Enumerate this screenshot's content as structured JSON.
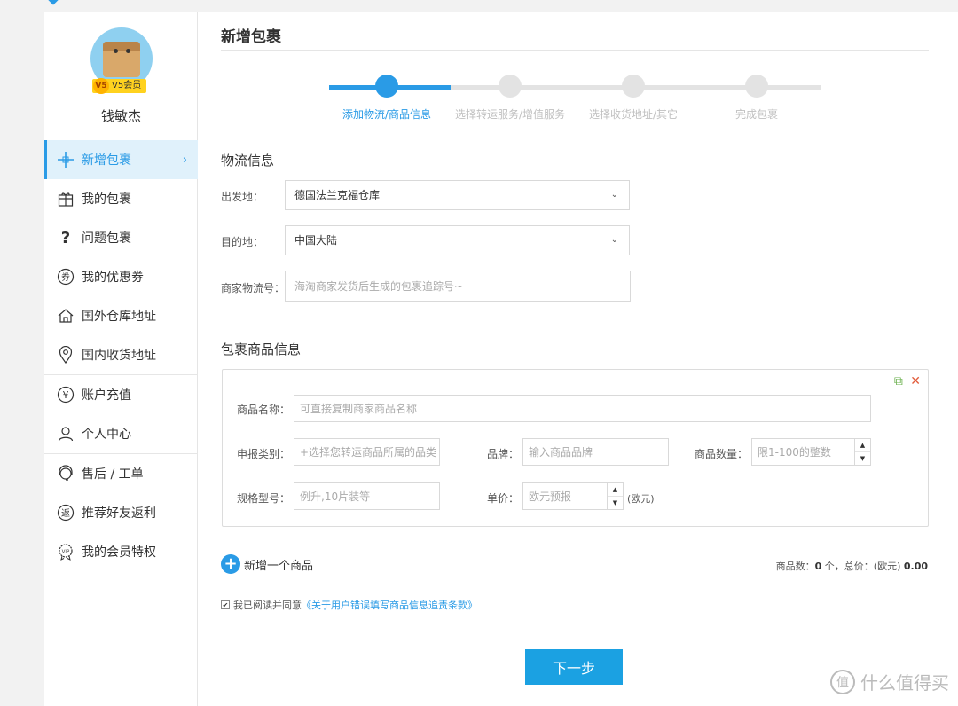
{
  "breadcrumb": "",
  "user": {
    "name": "钱敏杰",
    "vip_level": "V5",
    "vip_label": "V5会员"
  },
  "sidebar": {
    "items": [
      {
        "label": "新增包裹",
        "icon": "plus-icon",
        "active": true
      },
      {
        "label": "我的包裹",
        "icon": "gift-icon",
        "active": false
      },
      {
        "label": "问题包裹",
        "icon": "question-icon",
        "active": false
      },
      {
        "label": "我的优惠券",
        "icon": "coupon-icon",
        "active": false
      },
      {
        "label": "国外仓库地址",
        "icon": "house-icon",
        "active": false
      },
      {
        "label": "国内收货地址",
        "icon": "location-pin-icon",
        "active": false
      },
      {
        "label": "账户充值",
        "icon": "yen-icon",
        "active": false
      },
      {
        "label": "个人中心",
        "icon": "user-icon",
        "active": false
      },
      {
        "label": "售后 / 工单",
        "icon": "headset-icon",
        "active": false
      },
      {
        "label": "推荐好友返利",
        "icon": "rebate-icon",
        "active": false
      },
      {
        "label": "我的会员特权",
        "icon": "vip-icon",
        "active": false
      }
    ]
  },
  "page": {
    "title": "新增包裹"
  },
  "steps": [
    {
      "label": "添加物流/商品信息",
      "done": true
    },
    {
      "label": "选择转运服务/增值服务",
      "done": false
    },
    {
      "label": "选择收货地址/其它",
      "done": false
    },
    {
      "label": "完成包裹",
      "done": false
    }
  ],
  "logistics": {
    "section_title": "物流信息",
    "origin_label": "出发地：",
    "origin_value": "德国法兰克福仓库",
    "dest_label": "目的地：",
    "dest_value": "中国大陆",
    "tracking_label": "商家物流号：",
    "tracking_placeholder": "海淘商家发货后生成的包裹追踪号~"
  },
  "goods": {
    "section_title": "包裹商品信息",
    "name_label": "商品名称：",
    "name_placeholder": "可直接复制商家商品名称",
    "category_label": "申报类别：",
    "category_placeholder": "+选择您转运商品所属的品类",
    "brand_label": "品牌：",
    "brand_placeholder": "输入商品品牌",
    "qty_label": "商品数量：",
    "qty_placeholder": "限1-100的整数",
    "spec_label": "规格型号：",
    "spec_placeholder": "例升,10片装等",
    "price_label": "单价：",
    "price_placeholder": "欧元预报",
    "price_unit": "(欧元)"
  },
  "footer": {
    "add_goods": "新增一个商品",
    "summary_prefix": "商品数：",
    "summary_count": "0",
    "summary_mid": " 个，总价：(欧元) ",
    "summary_total": "0.00",
    "agree_prefix": "我已阅读并同意",
    "agree_link": "《关于用户错误填写商品信息追责条款》",
    "next_button": "下一步"
  },
  "watermark": {
    "text": "什么值得买",
    "icon_glyph": "值"
  }
}
